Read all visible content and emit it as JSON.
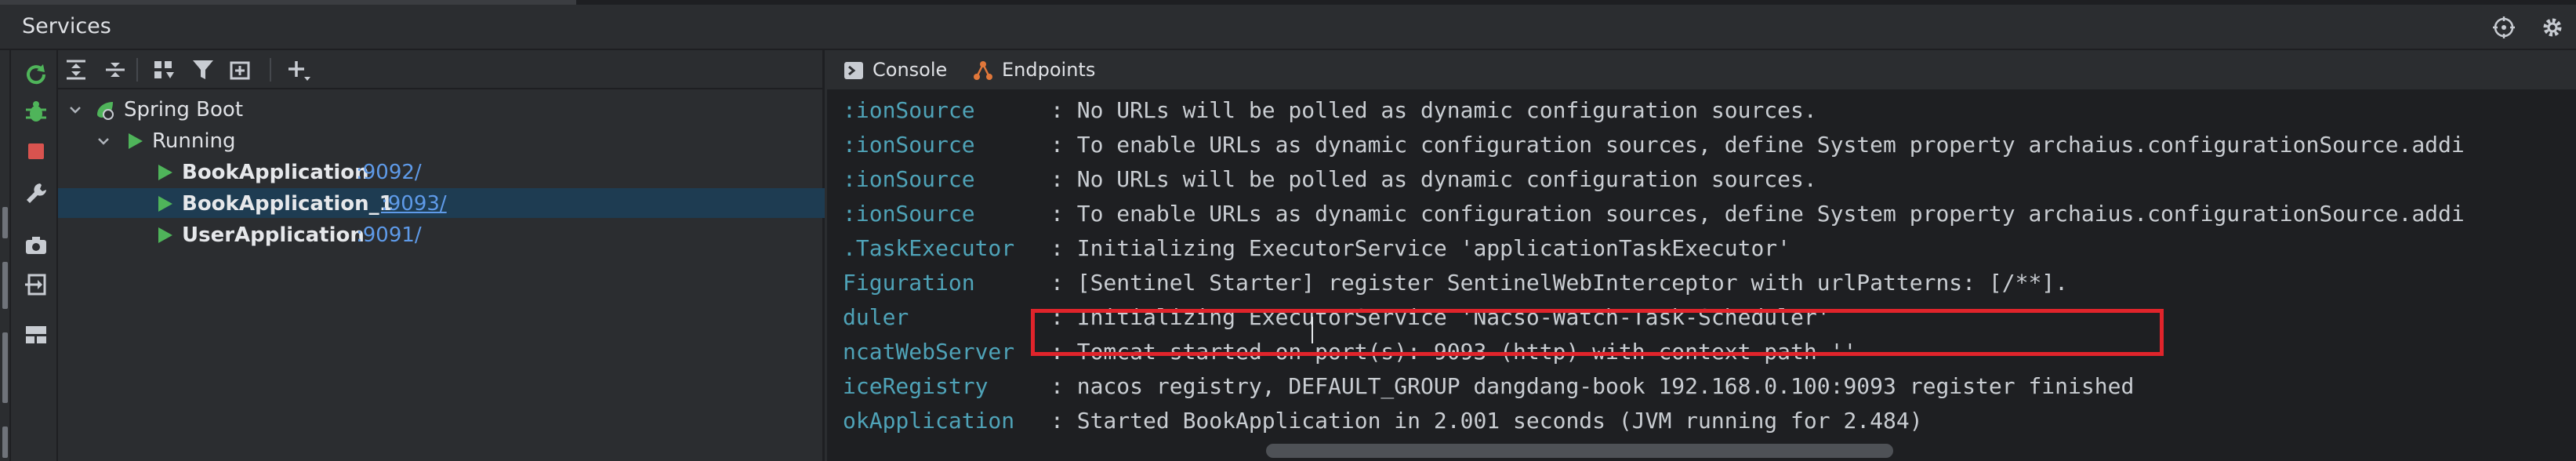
{
  "header": {
    "title": "Services",
    "icons": [
      "crosshair-icon",
      "gear-icon"
    ]
  },
  "left_toolbar": {
    "icons": [
      "rerun-icon",
      "debug-icon",
      "stop-icon",
      "wrench-icon",
      "camera-icon",
      "exit-icon",
      "layout-icon"
    ],
    "colors": {
      "rerun": "#4fb45a",
      "debug": "#4fb45a",
      "stop": "#d9534f"
    }
  },
  "tree_toolbar": {
    "icons": [
      "expand-all-icon",
      "collapse-all-icon",
      "group-by-icon",
      "filter-icon",
      "new-service-icon",
      "add-icon"
    ]
  },
  "tree": {
    "root": {
      "label": "Spring Boot",
      "icon": "spring-boot-icon"
    },
    "running": {
      "label": "Running",
      "icon": "run-icon"
    },
    "apps": [
      {
        "name": "BookApplication",
        "port": ":9092/"
      },
      {
        "name": "BookApplication_1",
        "port": ":9093/"
      },
      {
        "name": "UserApplication",
        "port": ":9091/"
      }
    ],
    "colors": {
      "run": "#4fb45a",
      "port_link": "#5e9ae8",
      "selection": "#1e3c52"
    }
  },
  "console_tabs": [
    {
      "label": "Console",
      "icon": "console-icon",
      "active": true
    },
    {
      "label": "Endpoints",
      "icon": "endpoints-icon",
      "active": false
    }
  ],
  "log": {
    "lines": [
      {
        "source": ":ionSource",
        "message": ": No URLs will be polled as dynamic configuration sources."
      },
      {
        "source": ":ionSource",
        "message": ": To enable URLs as dynamic configuration sources, define System property archaius.configurationSource.addi"
      },
      {
        "source": ":ionSource",
        "message": ": No URLs will be polled as dynamic configuration sources."
      },
      {
        "source": ":ionSource",
        "message": ": To enable URLs as dynamic configuration sources, define System property archaius.configurationSource.addi"
      },
      {
        "source": ".TaskExecutor",
        "message": ": Initializing ExecutorService 'applicationTaskExecutor'"
      },
      {
        "source": "Figuration",
        "message": ": [Sentinel Starter] register SentinelWebInterceptor with urlPatterns: [/**]."
      },
      {
        "source": "duler",
        "message": ": Initializing ExecutorService 'Nacso-Watch-Task-Scheduler'"
      },
      {
        "source": "ncatWebServer",
        "message": ": Tomcat started on port(s): 9093 (http) with context path ''"
      },
      {
        "source": "iceRegistry",
        "message": ": nacos registry, DEFAULT_GROUP dangdang-book 192.168.0.100:9093 register finished"
      },
      {
        "source": "okApplication",
        "message": ": Started BookApplication in 2.001 seconds (JVM running for 2.484)"
      }
    ],
    "colors": {
      "source": "#4fa3b8",
      "message": "#c9cdd2",
      "highlight": "#e0242b"
    }
  }
}
